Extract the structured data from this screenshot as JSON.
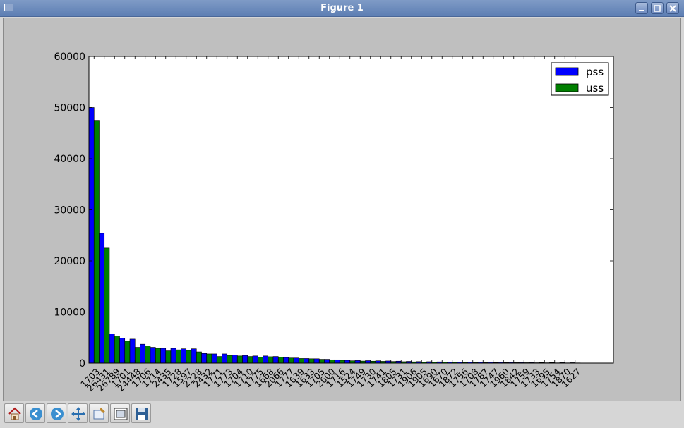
{
  "window": {
    "title": "Figure 1"
  },
  "toolbar": {
    "buttons": [
      {
        "icon": "home-icon"
      },
      {
        "icon": "back-arrow-icon"
      },
      {
        "icon": "forward-arrow-icon"
      },
      {
        "icon": "pan-arrows-icon"
      },
      {
        "icon": "zoom-rect-icon"
      },
      {
        "icon": "subplots-icon"
      },
      {
        "icon": "save-floppy-icon"
      }
    ]
  },
  "chart_data": {
    "type": "bar",
    "title": "",
    "xlabel": "",
    "ylabel": "",
    "ylim": [
      0,
      60000
    ],
    "yticks": [
      0,
      10000,
      20000,
      30000,
      40000,
      50000,
      60000
    ],
    "legend_position": "top-right",
    "grid": false,
    "colors": {
      "pss": "#0000ff",
      "uss": "#007f00",
      "background": "#bfbfbf",
      "plot_bg": "#ffffff"
    },
    "categories": [
      "1703",
      "26431",
      "26789",
      "1701",
      "24448",
      "1706",
      "1714",
      "2435",
      "1728",
      "1597",
      "2228",
      "2432",
      "1771",
      "1773",
      "1704",
      "1710",
      "1775",
      "1668",
      "2066",
      "1777",
      "1639",
      "1633",
      "1705",
      "2600",
      "1716",
      "1524",
      "1749",
      "1730",
      "1741",
      "1805",
      "1731",
      "1906",
      "1905",
      "1690",
      "1670",
      "1872",
      "1756",
      "1708",
      "1787",
      "1747",
      "1960",
      "1842",
      "1759",
      "1733",
      "1695",
      "1754",
      "1870",
      "1627"
    ],
    "series": [
      {
        "name": "pss",
        "values": [
          50000,
          25400,
          5700,
          4900,
          4700,
          3700,
          3100,
          2900,
          2900,
          2800,
          2800,
          1900,
          1800,
          1800,
          1600,
          1500,
          1400,
          1400,
          1300,
          1100,
          1000,
          900,
          850,
          750,
          650,
          550,
          500,
          480,
          450,
          420,
          380,
          340,
          300,
          280,
          250,
          220,
          200,
          180,
          170,
          160,
          150,
          140,
          130,
          120,
          110,
          100,
          90,
          80
        ]
      },
      {
        "name": "uss",
        "values": [
          47500,
          22500,
          5300,
          4300,
          3100,
          3400,
          2900,
          2400,
          2600,
          2500,
          2200,
          1800,
          1300,
          1500,
          1400,
          1300,
          1200,
          1250,
          1150,
          1000,
          900,
          850,
          750,
          650,
          550,
          450,
          400,
          380,
          350,
          320,
          280,
          250,
          220,
          200,
          180,
          160,
          140,
          130,
          120,
          110,
          100,
          90,
          80,
          70,
          60,
          50,
          45,
          40
        ]
      }
    ]
  }
}
